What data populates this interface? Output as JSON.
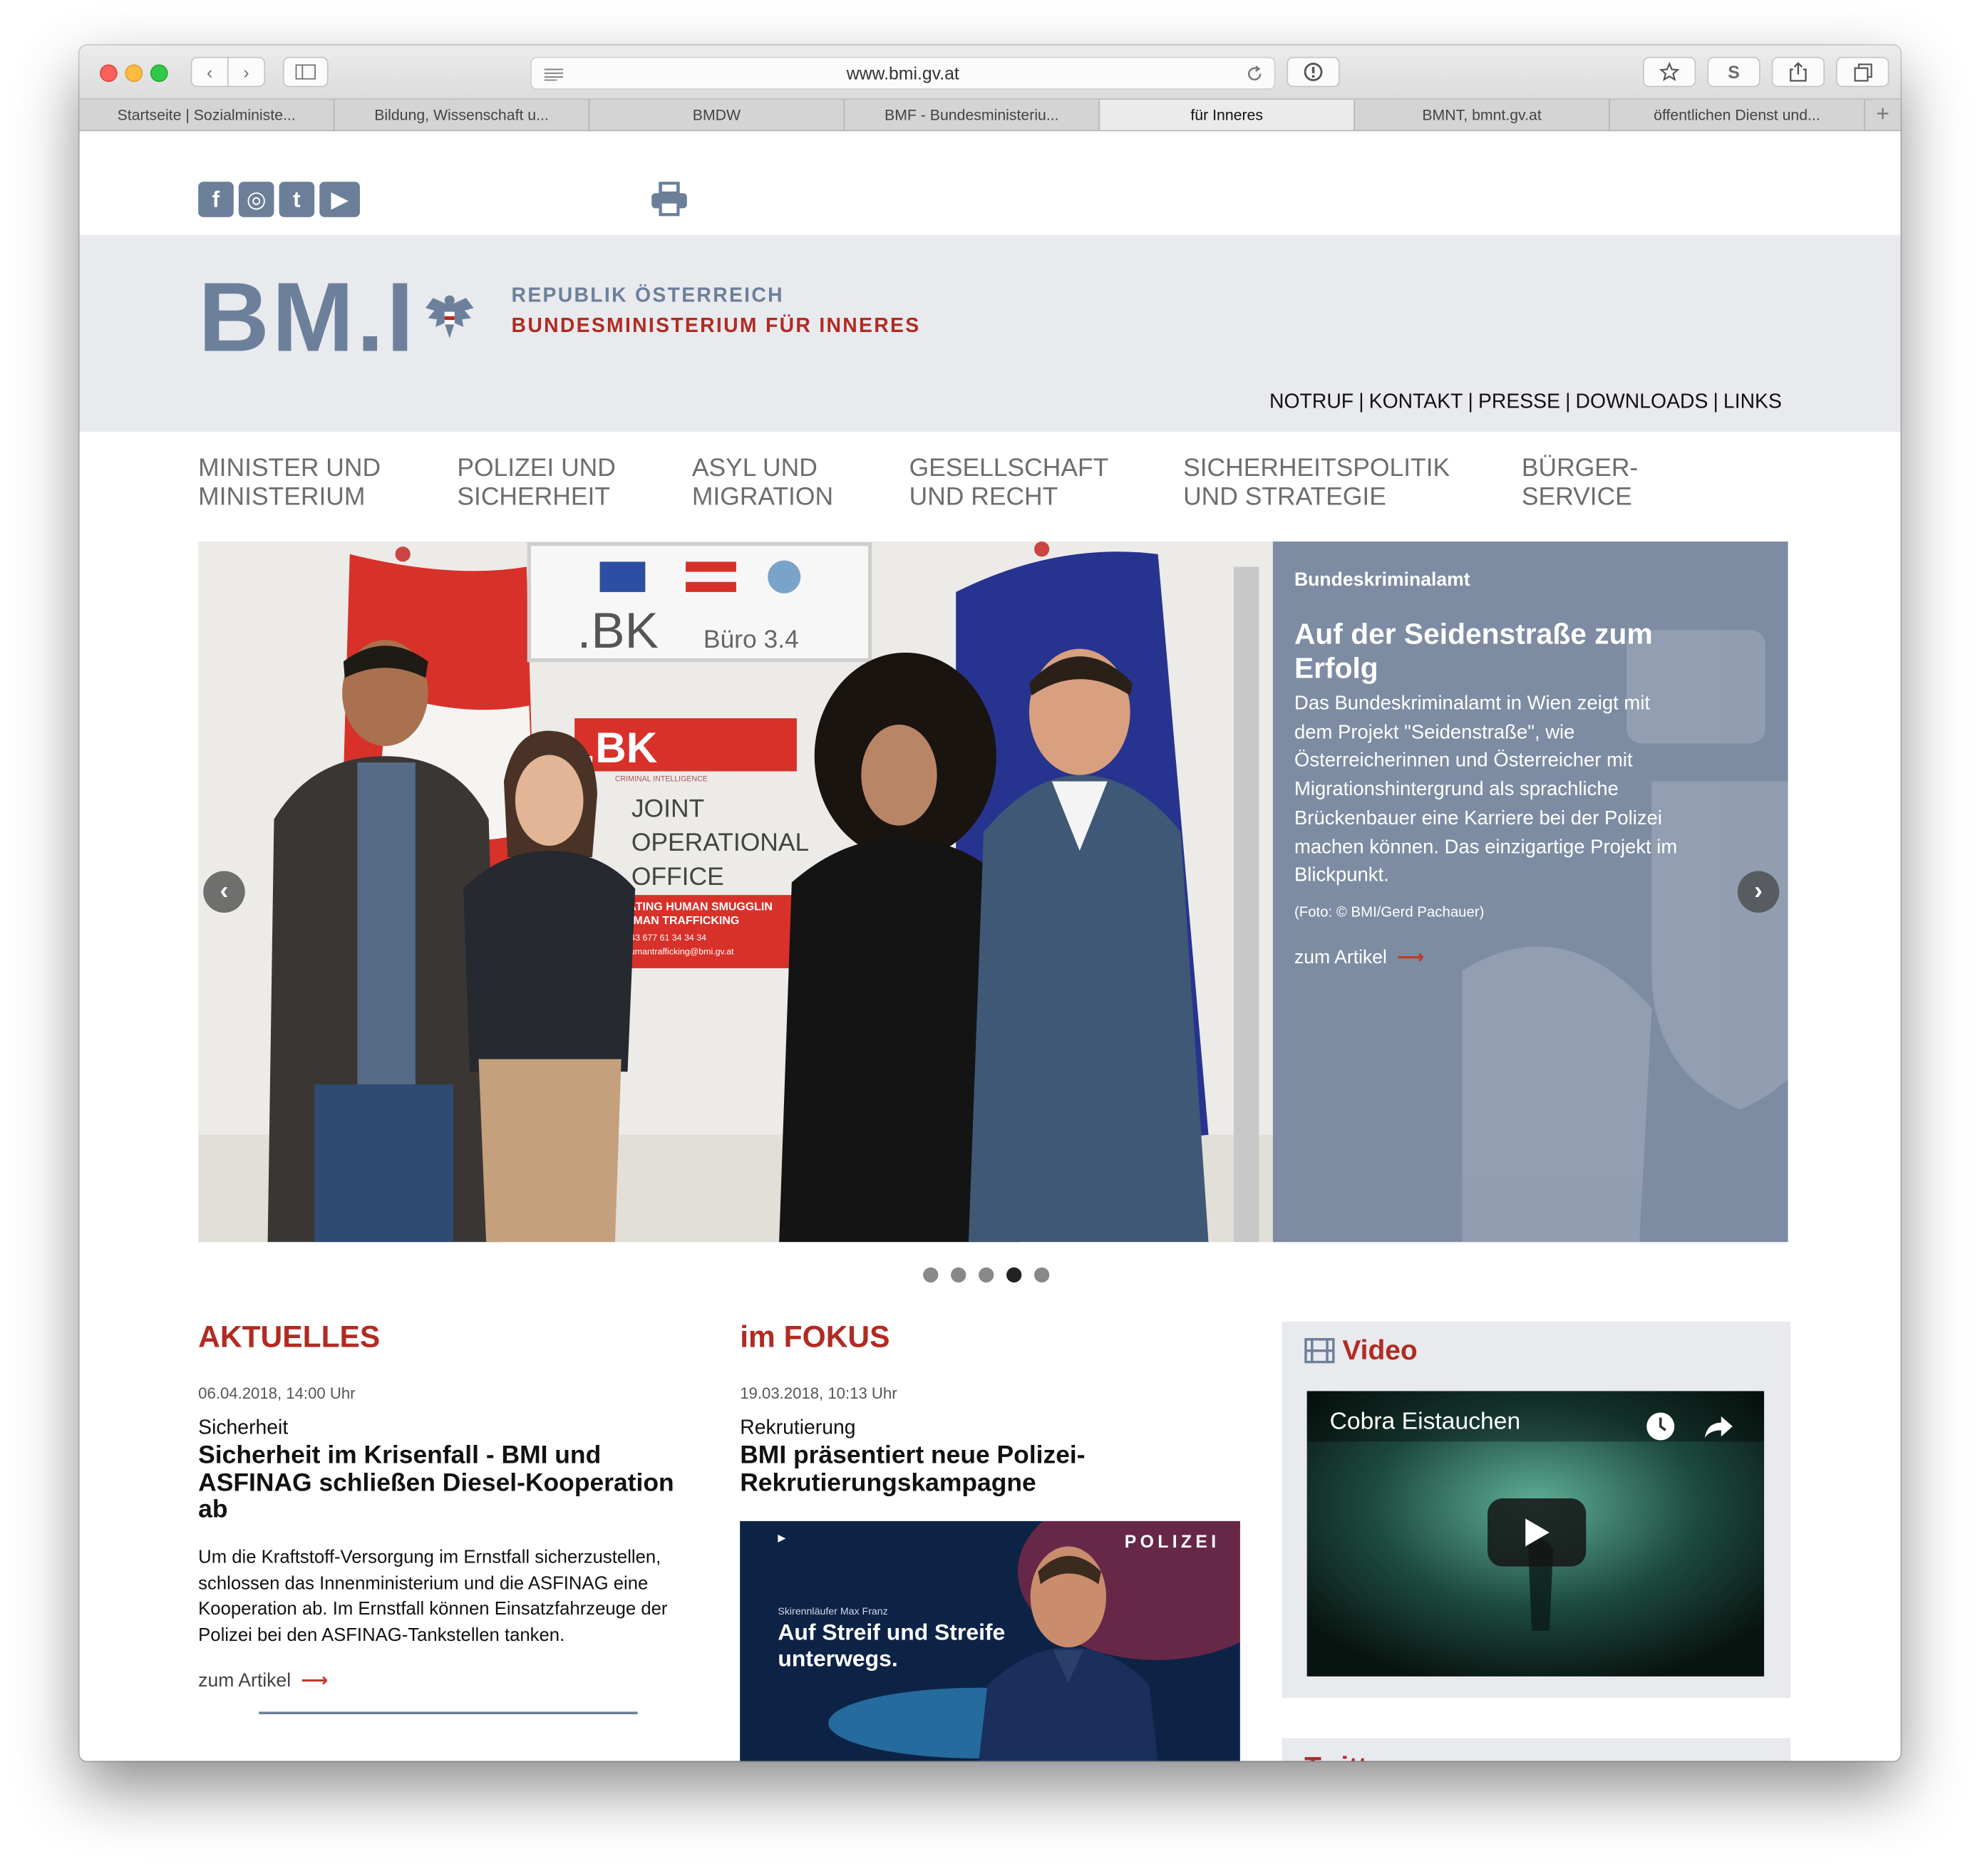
{
  "browser": {
    "url": "www.bmi.gv.at",
    "tabs": [
      {
        "label": "Startseite | Sozialministe..."
      },
      {
        "label": "Bildung, Wissenschaft u..."
      },
      {
        "label": "BMDW"
      },
      {
        "label": "BMF - Bundesministeriu..."
      },
      {
        "label": "für Inneres"
      },
      {
        "label": "BMNT, bmnt.gv.at"
      },
      {
        "label": "öffentlichen Dienst und..."
      }
    ],
    "new_tab_label": "+",
    "s_button_label": "S"
  },
  "social": {
    "facebook": "f",
    "instagram": "◎",
    "twitter": "t",
    "youtube": "▶"
  },
  "logo": {
    "mark": "BM.I",
    "line1": "REPUBLIK ÖSTERREICH",
    "line2": "BUNDESMINISTERIUM FÜR INNERES"
  },
  "toplinks": [
    "NOTRUF",
    "KONTAKT",
    "PRESSE",
    "DOWNLOADS",
    "LINKS"
  ],
  "toplinks_separator": "|",
  "nav": [
    "MINISTER UND\nMINISTERIUM",
    "POLIZEI UND\nSICHERHEIT",
    "ASYL UND\nMIGRATION",
    "GESELLSCHAFT\nUND RECHT",
    "SICHERHEITSPOLITIK\nUND STRATEGIE",
    "BÜRGER-\nSERVICE"
  ],
  "slider": {
    "category": "Bundeskriminalamt",
    "title": "Auf der Seidenstraße zum Erfolg",
    "text": "Das Bundeskriminalamt in Wien zeigt mit dem Projekt \"Seidenstraße\", wie Österreicherinnen und Österreicher mit Migrationshintergrund als sprachliche Brückenbauer eine Karriere bei der Polizei machen können. Das einzigartige Projekt im Blickpunkt.",
    "credit": "(Foto: ©  BMI/Gerd Pachauer)",
    "link": "zum Artikel",
    "link_arrow": "⟶",
    "dots_total": 5,
    "dots_active": 4,
    "photo_sign_top": ".BK",
    "photo_sign_room": "Büro 3.4",
    "photo_sign_bk": ".BK",
    "photo_sign_ci": "CRIMINAL INTELLIGENCE",
    "photo_sign_joint": "JOINT",
    "photo_sign_operational": "OPERATIONAL",
    "photo_sign_office": "OFFICE",
    "photo_sign_red1": "BATING HUMAN SMUGGLIN",
    "photo_sign_red2": "UMAN TRAFFICKING",
    "photo_sign_red3": "+43 677 61 34 34 34",
    "photo_sign_red4": "humantrafficking@bmi.gv.at"
  },
  "aktuelles": {
    "heading": "AKTUELLES",
    "date": "06.04.2018, 14:00 Uhr",
    "kicker": "Sicherheit",
    "headline": "Sicherheit im Krisenfall - BMI und ASFINAG schließen Diesel-Kooperation ab",
    "teaser": "Um die Kraftstoff-Versorgung im Ernstfall sicherzustellen, schlossen das Innenministerium und die ASFINAG eine Kooperation ab. Im Ernstfall können Einsatzfahrzeuge der Polizei bei den ASFINAG-Tankstellen tanken.",
    "link": "zum Artikel"
  },
  "fokus": {
    "heading": "im FOKUS",
    "date": "19.03.2018, 10:13 Uhr",
    "kicker": "Rekrutierung",
    "headline": "BMI präsentiert neue Polizei-Rekrutierungskampagne",
    "image_brand": "POLIZEI",
    "image_sub": "Skirennläufer Max Franz",
    "image_claim": "Auf Streif und Streife unterwegs.",
    "image_badge": "POLIZEI"
  },
  "video": {
    "heading": "Video",
    "clip_title": "Cobra Eistauchen"
  },
  "twitter": {
    "heading": "Twitter"
  },
  "colors": {
    "accent_red": "#b12b22",
    "brand_slate": "#6d809b",
    "panel": "#7d8ca3",
    "band": "#e8eaee"
  }
}
